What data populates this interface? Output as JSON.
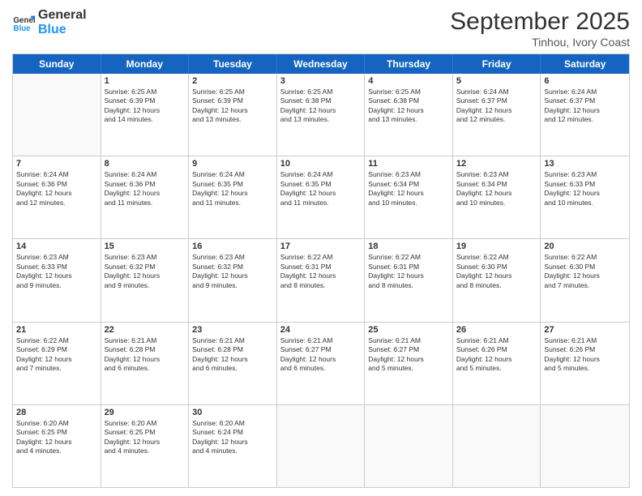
{
  "header": {
    "logo_general": "General",
    "logo_blue": "Blue",
    "month": "September 2025",
    "location": "Tinhou, Ivory Coast"
  },
  "weekdays": [
    "Sunday",
    "Monday",
    "Tuesday",
    "Wednesday",
    "Thursday",
    "Friday",
    "Saturday"
  ],
  "rows": [
    [
      {
        "day": "",
        "text": ""
      },
      {
        "day": "1",
        "text": "Sunrise: 6:25 AM\nSunset: 6:39 PM\nDaylight: 12 hours\nand 14 minutes."
      },
      {
        "day": "2",
        "text": "Sunrise: 6:25 AM\nSunset: 6:39 PM\nDaylight: 12 hours\nand 13 minutes."
      },
      {
        "day": "3",
        "text": "Sunrise: 6:25 AM\nSunset: 6:38 PM\nDaylight: 12 hours\nand 13 minutes."
      },
      {
        "day": "4",
        "text": "Sunrise: 6:25 AM\nSunset: 6:38 PM\nDaylight: 12 hours\nand 13 minutes."
      },
      {
        "day": "5",
        "text": "Sunrise: 6:24 AM\nSunset: 6:37 PM\nDaylight: 12 hours\nand 12 minutes."
      },
      {
        "day": "6",
        "text": "Sunrise: 6:24 AM\nSunset: 6:37 PM\nDaylight: 12 hours\nand 12 minutes."
      }
    ],
    [
      {
        "day": "7",
        "text": "Sunrise: 6:24 AM\nSunset: 6:36 PM\nDaylight: 12 hours\nand 12 minutes."
      },
      {
        "day": "8",
        "text": "Sunrise: 6:24 AM\nSunset: 6:36 PM\nDaylight: 12 hours\nand 11 minutes."
      },
      {
        "day": "9",
        "text": "Sunrise: 6:24 AM\nSunset: 6:35 PM\nDaylight: 12 hours\nand 11 minutes."
      },
      {
        "day": "10",
        "text": "Sunrise: 6:24 AM\nSunset: 6:35 PM\nDaylight: 12 hours\nand 11 minutes."
      },
      {
        "day": "11",
        "text": "Sunrise: 6:23 AM\nSunset: 6:34 PM\nDaylight: 12 hours\nand 10 minutes."
      },
      {
        "day": "12",
        "text": "Sunrise: 6:23 AM\nSunset: 6:34 PM\nDaylight: 12 hours\nand 10 minutes."
      },
      {
        "day": "13",
        "text": "Sunrise: 6:23 AM\nSunset: 6:33 PM\nDaylight: 12 hours\nand 10 minutes."
      }
    ],
    [
      {
        "day": "14",
        "text": "Sunrise: 6:23 AM\nSunset: 6:33 PM\nDaylight: 12 hours\nand 9 minutes."
      },
      {
        "day": "15",
        "text": "Sunrise: 6:23 AM\nSunset: 6:32 PM\nDaylight: 12 hours\nand 9 minutes."
      },
      {
        "day": "16",
        "text": "Sunrise: 6:23 AM\nSunset: 6:32 PM\nDaylight: 12 hours\nand 9 minutes."
      },
      {
        "day": "17",
        "text": "Sunrise: 6:22 AM\nSunset: 6:31 PM\nDaylight: 12 hours\nand 8 minutes."
      },
      {
        "day": "18",
        "text": "Sunrise: 6:22 AM\nSunset: 6:31 PM\nDaylight: 12 hours\nand 8 minutes."
      },
      {
        "day": "19",
        "text": "Sunrise: 6:22 AM\nSunset: 6:30 PM\nDaylight: 12 hours\nand 8 minutes."
      },
      {
        "day": "20",
        "text": "Sunrise: 6:22 AM\nSunset: 6:30 PM\nDaylight: 12 hours\nand 7 minutes."
      }
    ],
    [
      {
        "day": "21",
        "text": "Sunrise: 6:22 AM\nSunset: 6:29 PM\nDaylight: 12 hours\nand 7 minutes."
      },
      {
        "day": "22",
        "text": "Sunrise: 6:21 AM\nSunset: 6:28 PM\nDaylight: 12 hours\nand 6 minutes."
      },
      {
        "day": "23",
        "text": "Sunrise: 6:21 AM\nSunset: 6:28 PM\nDaylight: 12 hours\nand 6 minutes."
      },
      {
        "day": "24",
        "text": "Sunrise: 6:21 AM\nSunset: 6:27 PM\nDaylight: 12 hours\nand 6 minutes."
      },
      {
        "day": "25",
        "text": "Sunrise: 6:21 AM\nSunset: 6:27 PM\nDaylight: 12 hours\nand 5 minutes."
      },
      {
        "day": "26",
        "text": "Sunrise: 6:21 AM\nSunset: 6:26 PM\nDaylight: 12 hours\nand 5 minutes."
      },
      {
        "day": "27",
        "text": "Sunrise: 6:21 AM\nSunset: 6:26 PM\nDaylight: 12 hours\nand 5 minutes."
      }
    ],
    [
      {
        "day": "28",
        "text": "Sunrise: 6:20 AM\nSunset: 6:25 PM\nDaylight: 12 hours\nand 4 minutes."
      },
      {
        "day": "29",
        "text": "Sunrise: 6:20 AM\nSunset: 6:25 PM\nDaylight: 12 hours\nand 4 minutes."
      },
      {
        "day": "30",
        "text": "Sunrise: 6:20 AM\nSunset: 6:24 PM\nDaylight: 12 hours\nand 4 minutes."
      },
      {
        "day": "",
        "text": ""
      },
      {
        "day": "",
        "text": ""
      },
      {
        "day": "",
        "text": ""
      },
      {
        "day": "",
        "text": ""
      }
    ]
  ]
}
